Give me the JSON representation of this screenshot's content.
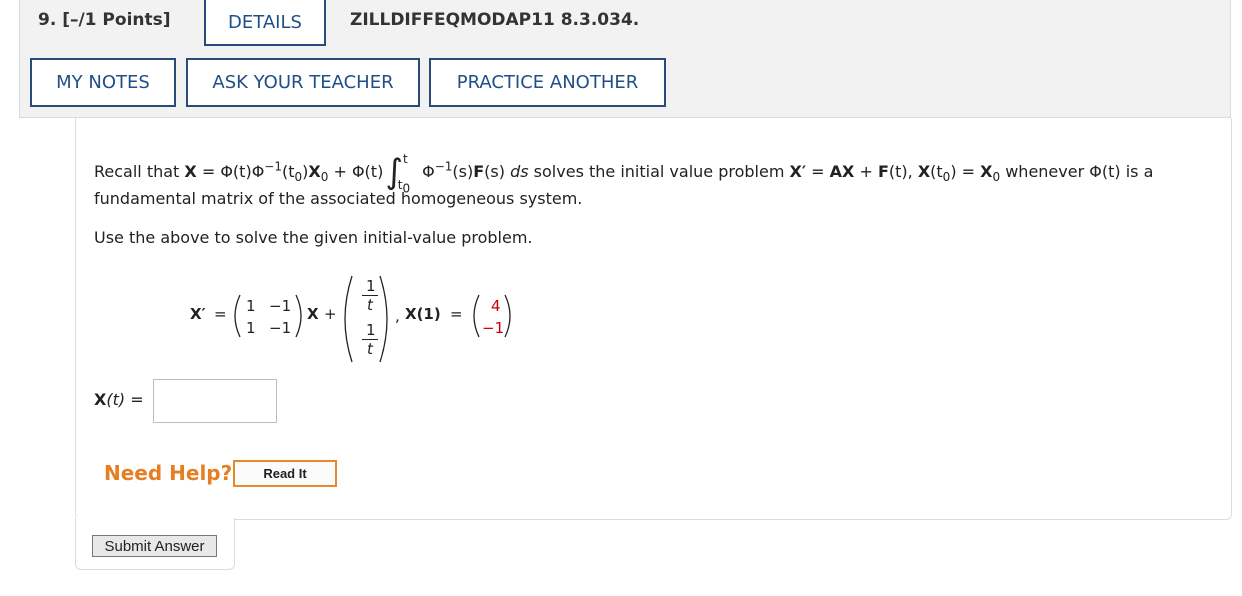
{
  "header": {
    "points": "9. [–/1 Points]",
    "details_label": "DETAILS",
    "problem_id": "ZILLDIFFEQMODAP11 8.3.034.",
    "my_notes_label": "MY NOTES",
    "ask_teacher_label": "ASK YOUR TEACHER",
    "practice_label": "PRACTICE ANOTHER"
  },
  "problem": {
    "recall_prefix": "Recall that ",
    "bold_X": "X",
    "eq": " = ",
    "phi": "Φ",
    "t_arg": "(t)",
    "phi_inv_t0": "(t",
    "sub0": "0",
    "close_paren": ")",
    "X0_X": "X",
    "plus": " + ",
    "int_upper": "t",
    "int_lower": "t",
    "inv_sup": "−1",
    "s_arg": "(s)",
    "F": "F",
    "ds": "ds",
    "solves": " solves the initial value problem ",
    "Xprime": "X′",
    "AX": "AX",
    "Ft": "F",
    "whenever": " whenever ",
    "isa": " is a",
    "line2": "fundamental matrix of the associated homogeneous system.",
    "line3": "Use the above to solve the given initial-value problem."
  },
  "system": {
    "xprime_label": "X′",
    "eq_sign": "=",
    "matrix_A": [
      [
        "1",
        "−1"
      ],
      [
        "1",
        "−1"
      ]
    ],
    "X_label": "X",
    "plus": "+",
    "forcing_num": [
      "1",
      "1"
    ],
    "forcing_den": [
      "t",
      "t"
    ],
    "comma": ",",
    "init_label": "X(1)",
    "init_eq": "=",
    "init_vector": [
      "4",
      "−1"
    ]
  },
  "answer": {
    "label_X": "X",
    "label_t": "(t)",
    "label_eq": "=",
    "value": ""
  },
  "help": {
    "need_help": "Need Help?",
    "read_it": "Read It"
  },
  "submit_label": "Submit Answer",
  "colors": {
    "accent": "#1f4f86",
    "help_orange": "#e67e22",
    "initial_red": "#cc0000"
  }
}
